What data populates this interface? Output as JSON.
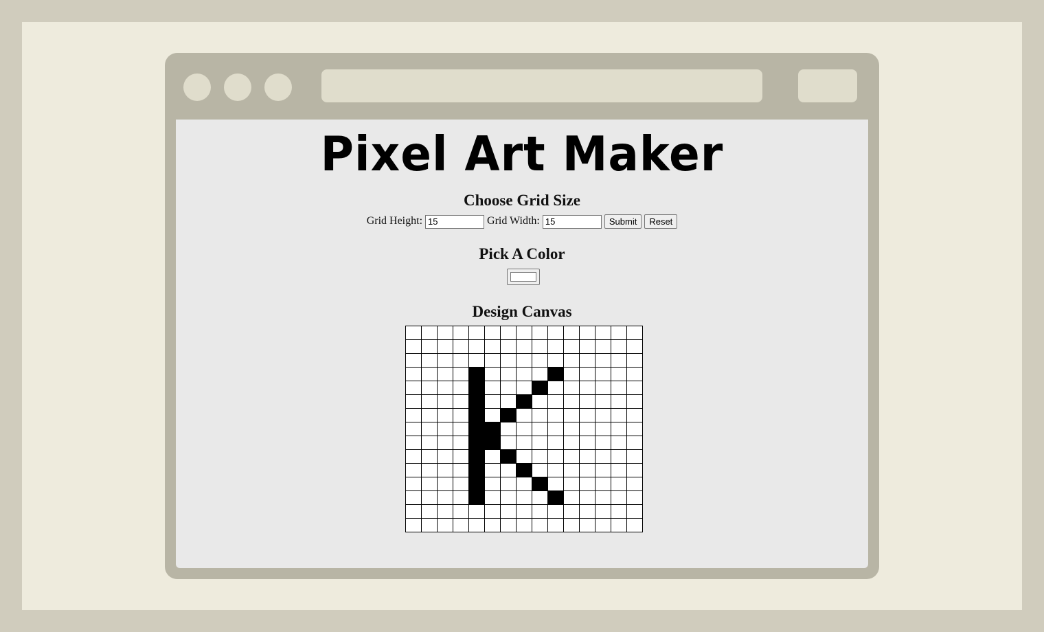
{
  "app": {
    "title": "Pixel Art Maker"
  },
  "grid_size": {
    "heading": "Choose Grid Size",
    "height_label": "Grid Height:",
    "height_value": "15",
    "width_label": "Grid Width:",
    "width_value": "15",
    "submit_label": "Submit",
    "reset_label": "Reset"
  },
  "color": {
    "heading": "Pick A Color",
    "value": "#ffffff"
  },
  "canvas": {
    "heading": "Design Canvas",
    "rows": 15,
    "cols": 15,
    "fill_color": "#000000",
    "filled_cells": [
      [
        3,
        4
      ],
      [
        3,
        9
      ],
      [
        4,
        4
      ],
      [
        4,
        8
      ],
      [
        5,
        4
      ],
      [
        5,
        7
      ],
      [
        6,
        4
      ],
      [
        6,
        6
      ],
      [
        7,
        4
      ],
      [
        7,
        5
      ],
      [
        8,
        4
      ],
      [
        8,
        5
      ],
      [
        9,
        4
      ],
      [
        9,
        6
      ],
      [
        10,
        4
      ],
      [
        10,
        7
      ],
      [
        11,
        4
      ],
      [
        11,
        8
      ],
      [
        12,
        4
      ],
      [
        12,
        9
      ]
    ]
  }
}
